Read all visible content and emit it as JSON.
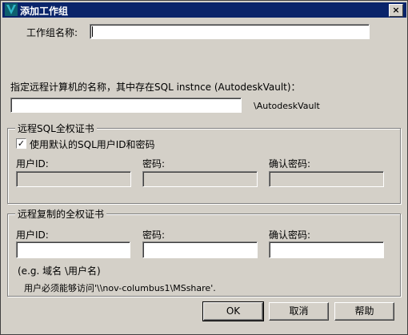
{
  "window": {
    "title": "添加工作组",
    "close_glyph": "×"
  },
  "workgroup": {
    "label": "工作组名称:",
    "value": ""
  },
  "remote_machine": {
    "label": "指定远程计算机的名称，其中存在SQL instnce (AutodeskVault)：",
    "value": "",
    "suffix": "\\AutodeskVault"
  },
  "sql_group": {
    "title": "远程SQL全权证书",
    "use_default_label": "使用默认的SQL用户ID和密码",
    "use_default_checked": true,
    "check_glyph": "✓",
    "user_id_label": "用户ID:",
    "password_label": "密码:",
    "confirm_label": "确认密码:"
  },
  "replication_group": {
    "title": "远程复制的全权证书",
    "user_id_label": "用户ID:",
    "password_label": "密码:",
    "confirm_label": "确认密码:",
    "hint_format": "(e.g. 域名 \\用户名)",
    "hint_access": "用户必须能够访问'\\\\nov-columbus1\\MSshare'."
  },
  "buttons": {
    "ok": "OK",
    "cancel": "取消",
    "help": "帮助"
  },
  "icons": {
    "app": "vault-app-icon",
    "close": "close-icon",
    "check": "checkmark-icon"
  },
  "colors": {
    "titlebar": "#0a246a",
    "face": "#d4d0c8",
    "app_icon": "#1a8a9a"
  }
}
